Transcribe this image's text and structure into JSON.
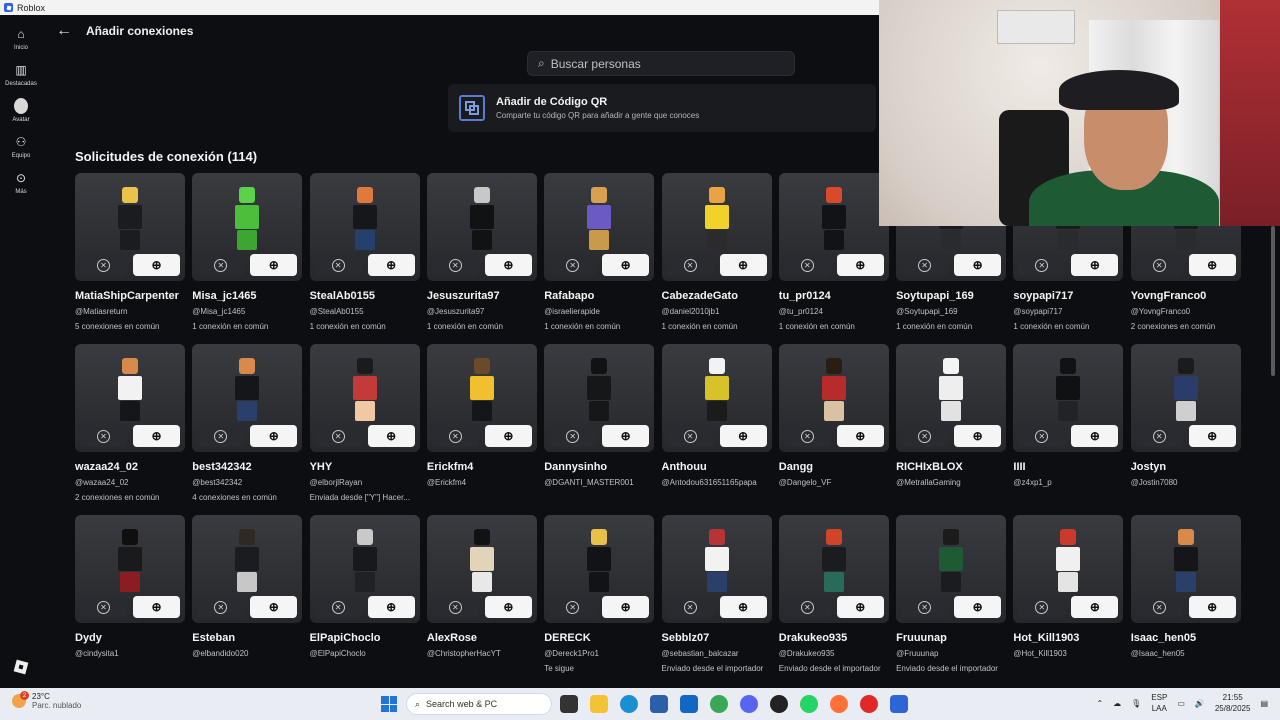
{
  "window": {
    "title": "Roblox"
  },
  "nav": [
    {
      "label": "Inicio",
      "icon": "home-icon"
    },
    {
      "label": "Destacadas",
      "icon": "chart-icon"
    },
    {
      "label": "Avatar",
      "icon": "avatar-icon"
    },
    {
      "label": "Equipo",
      "icon": "group-icon"
    },
    {
      "label": "Más",
      "icon": "more-icon"
    }
  ],
  "header": {
    "back_icon": "arrow-left-icon",
    "title": "Añadir conexiones"
  },
  "search": {
    "placeholder": "Buscar personas"
  },
  "qr": {
    "title": "Añadir de Código QR",
    "subtitle": "Comparte tu código QR para añadir a gente que conoces"
  },
  "section": {
    "title": "Solicitudes de conexión (114)"
  },
  "requests": [
    {
      "name": "MatiaShipCarpenter",
      "handle": "@Matiasreturn",
      "info": "5 conexiones en común",
      "colors": [
        "#e9c34b",
        "#1b1c1f",
        "#1b1c1f"
      ]
    },
    {
      "name": "Misa_jc1465",
      "handle": "@Misa_jc1465",
      "info": "1 conexión en común",
      "colors": [
        "#5ad24a",
        "#4bbf3c",
        "#3da532"
      ]
    },
    {
      "name": "StealAb0155",
      "handle": "@StealAb0155",
      "info": "1 conexión en común",
      "colors": [
        "#e07a3b",
        "#16171a",
        "#25406b"
      ]
    },
    {
      "name": "Jesuszurita97",
      "handle": "@Jesuszurita97",
      "info": "1 conexión en común",
      "colors": [
        "#c8c8c8",
        "#111214",
        "#111214"
      ]
    },
    {
      "name": "Rafabapo",
      "handle": "@israelierapide",
      "info": "1 conexión en común",
      "colors": [
        "#d7a24f",
        "#6a5ac2",
        "#c89a4a"
      ]
    },
    {
      "name": "CabezadeGato",
      "handle": "@daniel2010jb1",
      "info": "1 conexión en común",
      "colors": [
        "#e9a244",
        "#f0d22b",
        "#2b2b2b"
      ]
    },
    {
      "name": "tu_pr0124",
      "handle": "@tu_pr0124",
      "info": "1 conexión en común",
      "colors": [
        "#d84a2a",
        "#121316",
        "#121316"
      ]
    },
    {
      "name": "Soytupapi_169",
      "handle": "@Soytupapi_169",
      "info": "1 conexión en común",
      "colors": [
        "#c9c9c9",
        "#1a1b1e",
        "#2a2b2f"
      ]
    },
    {
      "name": "soypapi717",
      "handle": "@soypapi717",
      "info": "1 conexión en común",
      "colors": [
        "#c9c9c9",
        "#1a1b1e",
        "#2a2b2f"
      ]
    },
    {
      "name": "YovngFranco0",
      "handle": "@YovngFranco0",
      "info": "2 conexiones en común",
      "colors": [
        "#c9c9c9",
        "#1a1b1e",
        "#2a2b2f"
      ]
    },
    {
      "name": "wazaa24_02",
      "handle": "@wazaa24_02",
      "info": "2 conexiones en común",
      "colors": [
        "#d88a4a",
        "#f2f2f2",
        "#151619"
      ]
    },
    {
      "name": "best342342",
      "handle": "@best342342",
      "info": "4 conexiones en común",
      "colors": [
        "#d88a4a",
        "#151619",
        "#2a3f6a"
      ]
    },
    {
      "name": "YHY",
      "handle": "@elborjlRayan",
      "info": "Enviada desde [\"Y\"] Hacer...",
      "colors": [
        "#1b1b1b",
        "#c23a3a",
        "#f0c8a4"
      ]
    },
    {
      "name": "Erickfm4",
      "handle": "@Erickfm4",
      "info": "",
      "colors": [
        "#6a4a2a",
        "#f0c030",
        "#151619"
      ]
    },
    {
      "name": "Dannysinho",
      "handle": "@DGANTI_MASTER001",
      "info": "",
      "colors": [
        "#111214",
        "#161719",
        "#161719"
      ]
    },
    {
      "name": "Anthouu",
      "handle": "@Antodou631651165papa",
      "info": "",
      "colors": [
        "#f2f2f2",
        "#d8c22a",
        "#1b1b1b"
      ]
    },
    {
      "name": "Dangg",
      "handle": "@Dangelo_VF",
      "info": "",
      "colors": [
        "#2a1d14",
        "#b82b2b",
        "#d8c2a2"
      ]
    },
    {
      "name": "RICHIxBLOX",
      "handle": "@MetrallaGaming",
      "info": "",
      "colors": [
        "#f4f4f4",
        "#eeeeee",
        "#e2e2e2"
      ]
    },
    {
      "name": "IIII",
      "handle": "@z4xp1_p",
      "info": "",
      "colors": [
        "#111214",
        "#101113",
        "#222326"
      ]
    },
    {
      "name": "Jostyn",
      "handle": "@Jostin7080",
      "info": "",
      "colors": [
        "#1b1b1b",
        "#2a3d6a",
        "#cfcfcf"
      ]
    },
    {
      "name": "Dydy",
      "handle": "@cindysita1",
      "info": "",
      "colors": [
        "#0f0f10",
        "#1a1a1c",
        "#8a1d22"
      ]
    },
    {
      "name": "Esteban",
      "handle": "@elbandido020",
      "info": "",
      "colors": [
        "#2e2a22",
        "#1b1c1f",
        "#c7c7c7"
      ]
    },
    {
      "name": "ElPapiChoclo",
      "handle": "@ElPapiChoclo",
      "info": "",
      "colors": [
        "#c9c9c9",
        "#18191c",
        "#202124"
      ]
    },
    {
      "name": "AlexRose",
      "handle": "@ChristopherHacYT",
      "info": "",
      "colors": [
        "#111214",
        "#e2d4b8",
        "#e8e8e8"
      ]
    },
    {
      "name": "DERECK",
      "handle": "@Dereck1Pro1",
      "info": "Te sigue",
      "colors": [
        "#e8c04a",
        "#121316",
        "#121316"
      ]
    },
    {
      "name": "Sebblz07",
      "handle": "@sebastian_balcazar",
      "info": "Enviado desde el importador",
      "colors": [
        "#b83434",
        "#f2f2f2",
        "#2a3f6a"
      ]
    },
    {
      "name": "Drakukeo935",
      "handle": "@Drakukeo935",
      "info": "Enviado desde el importador",
      "colors": [
        "#d0452a",
        "#1b1c1f",
        "#2a6a5a"
      ]
    },
    {
      "name": "Fruuunap",
      "handle": "@Fruuunap",
      "info": "Enviado desde el importador",
      "colors": [
        "#1b1b1b",
        "#1e5a34",
        "#1b1c1f"
      ]
    },
    {
      "name": "Hot_Kill1903",
      "handle": "@Hot_Kill1903",
      "info": "",
      "colors": [
        "#c9392c",
        "#f0f0f0",
        "#e4e4e4"
      ]
    },
    {
      "name": "Isaac_hen05",
      "handle": "@Isaac_hen05",
      "info": "",
      "colors": [
        "#d88a4a",
        "#151619",
        "#2a3f6a"
      ]
    }
  ],
  "taskbar": {
    "weather": {
      "temp": "23°C",
      "desc": "Parc. nublado",
      "badge": "2"
    },
    "search_placeholder": "Search web & PC",
    "lang": {
      "line1": "ESP",
      "line2": "LAA"
    },
    "clock": {
      "time": "21:55",
      "date": "25/8/2025"
    }
  }
}
